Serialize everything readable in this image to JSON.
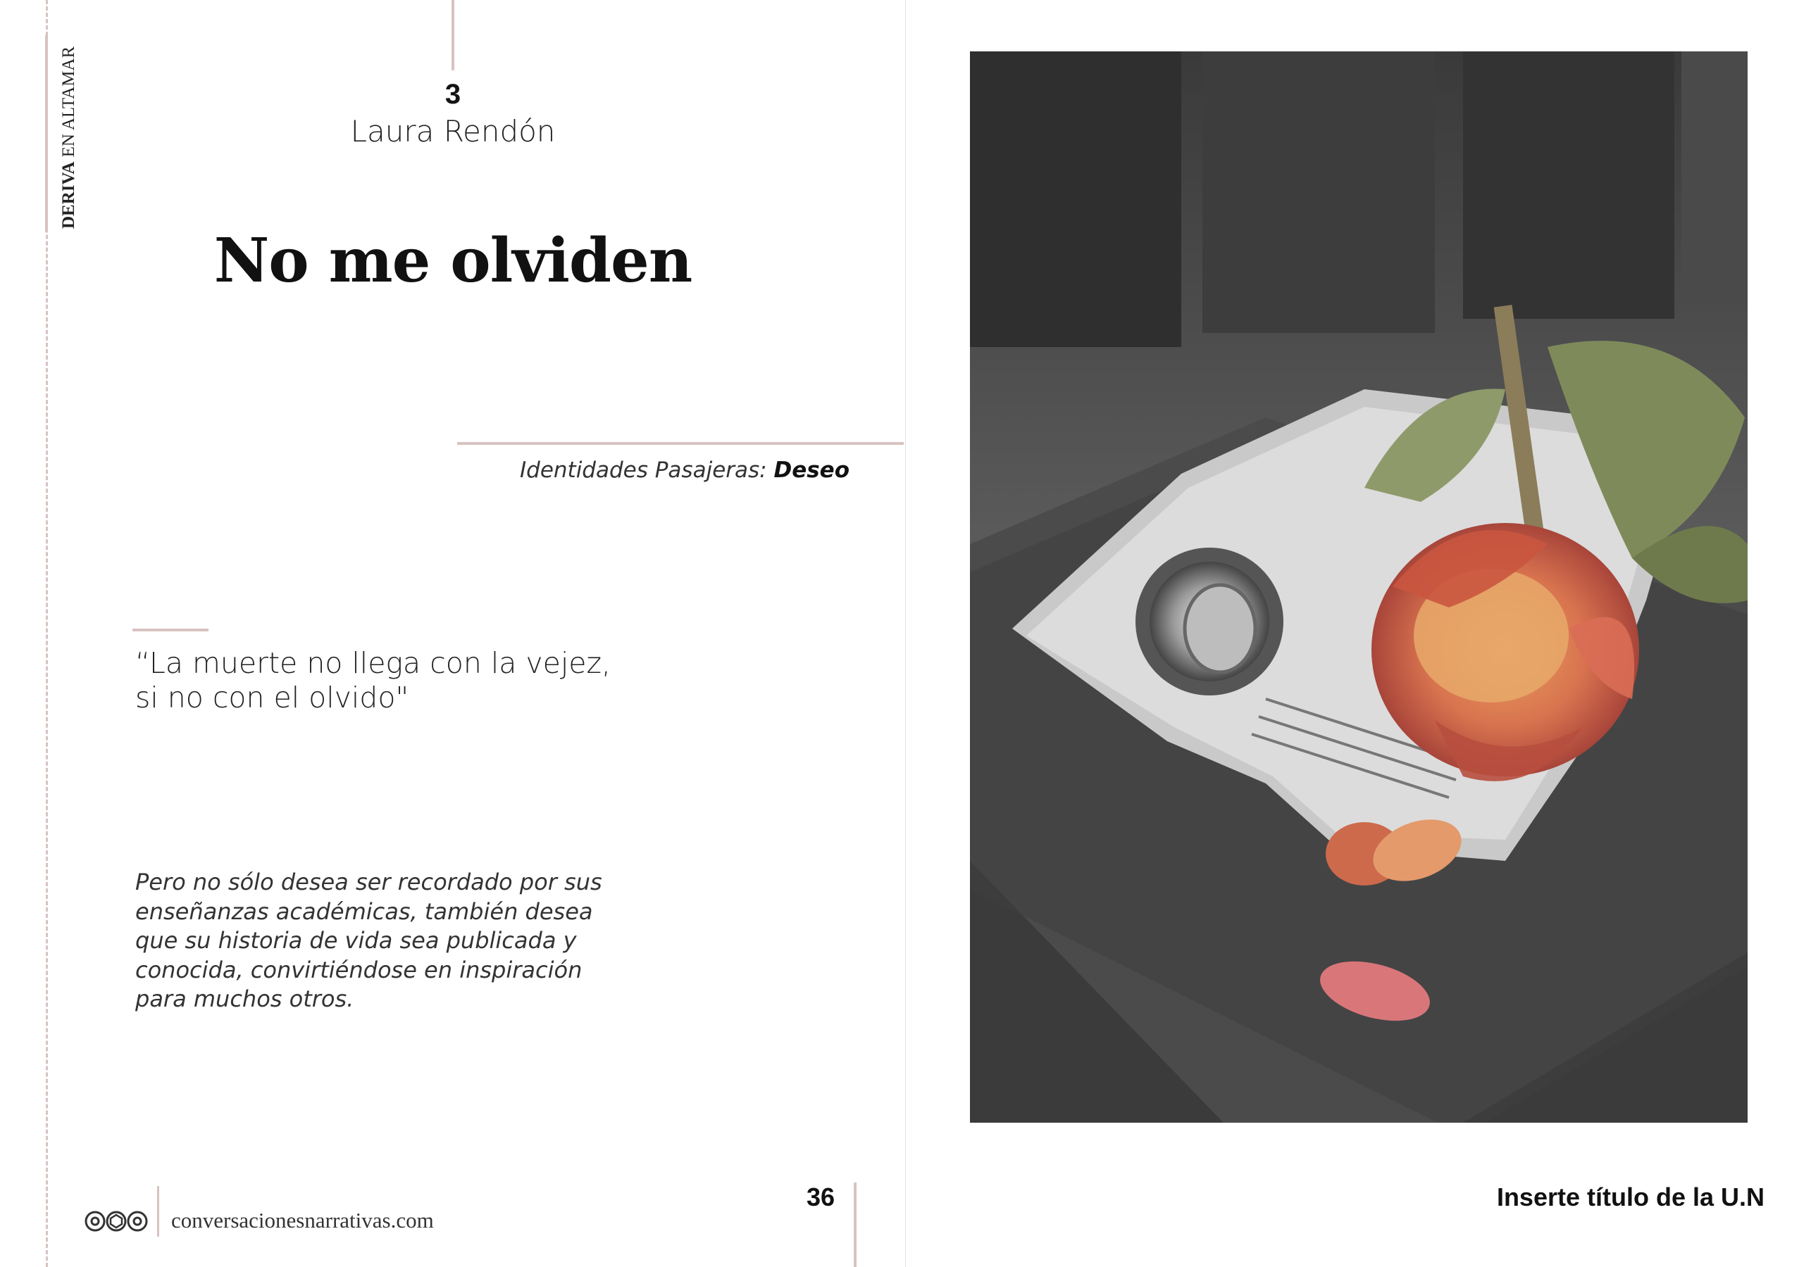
{
  "header": {
    "magazine_name_bold": "DERIVA",
    "magazine_name_rest": " EN ALTAMAR",
    "chapter_number": "3",
    "author": "Laura Rendón",
    "title": "No me olviden"
  },
  "section": {
    "label": "Identidades Pasajeras:",
    "value": "Deseo"
  },
  "quote": {
    "lines": [
      "“La muerte no llega con la vejez,",
      "si no con el olvido\""
    ]
  },
  "body": {
    "lines": [
      "Pero no sólo desea ser recordado por sus",
      "enseñanzas académicas, también  desea",
      "que su historia de vida sea publicada y",
      "conocida, convirtiéndose en inspiración",
      "para muchos otros."
    ]
  },
  "footer": {
    "logo_icon": "cc-license-icons",
    "website": "conversacionesnarrativas.com",
    "page_number": "36",
    "right_title": "Inserte título de la U.N"
  },
  "image": {
    "subject": "rose-ring-book-photo"
  },
  "colors": {
    "accent_rule": "#d8c3c1",
    "text": "#141414"
  }
}
